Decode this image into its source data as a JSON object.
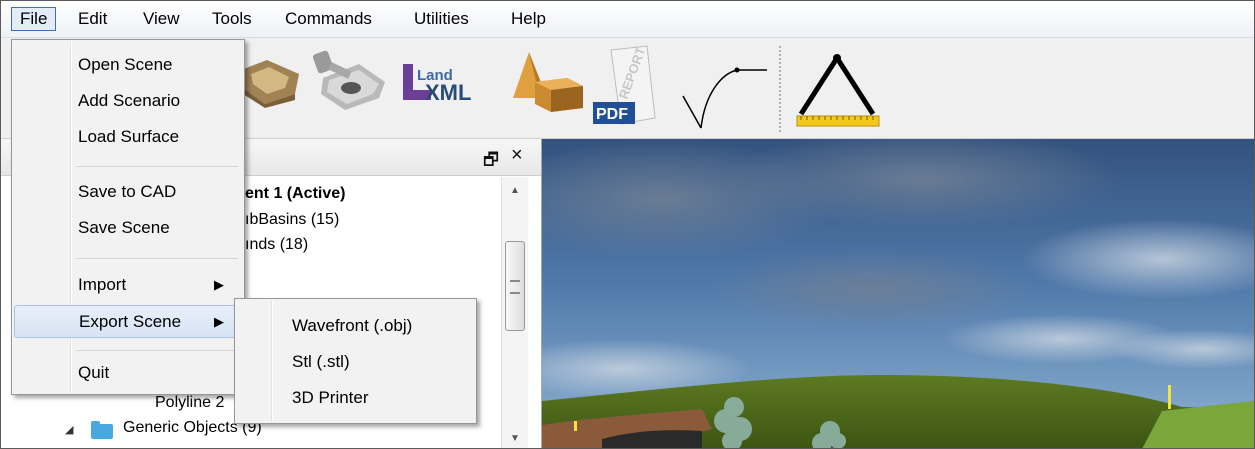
{
  "menubar": {
    "items": [
      "File",
      "Edit",
      "View",
      "Tools",
      "Commands",
      "Utilities",
      "Help"
    ]
  },
  "toolbar": {
    "icons": [
      "basin-icon",
      "inlet-structure-icon",
      "landxml-icon",
      "solid-shapes-icon",
      "pdf-report-icon",
      "curve-icon",
      "measure-icon"
    ],
    "landxml_top": "Land",
    "landxml_bottom": "XML",
    "pdf_label": "PDF",
    "report_label": "REPORT"
  },
  "panel": {
    "restore_glyph": "🗗",
    "close_glyph": "×",
    "tree": {
      "row1": "ent 1 (Active)",
      "row2": "ıbBasins (15)",
      "row3": "ınds (18)",
      "row4": "Polyline 2",
      "row5": "Generic Objects (9)"
    }
  },
  "file_menu": {
    "items": {
      "open_scene": "Open Scene",
      "add_scenario": "Add Scenario",
      "load_surface": "Load Surface",
      "save_to_cad": "Save to CAD",
      "save_scene": "Save Scene",
      "import": "Import",
      "export_scene": "Export Scene",
      "quit": "Quit"
    }
  },
  "export_submenu": {
    "items": {
      "wavefront": "Wavefront (.obj)",
      "stl": "Stl (.stl)",
      "printer": "3D Printer"
    }
  },
  "colors": {
    "accent_border": "#3b6fb5",
    "folder": "#4aa8e0",
    "sky_top": "#3c5b86",
    "grass": "#4e6b1a"
  }
}
